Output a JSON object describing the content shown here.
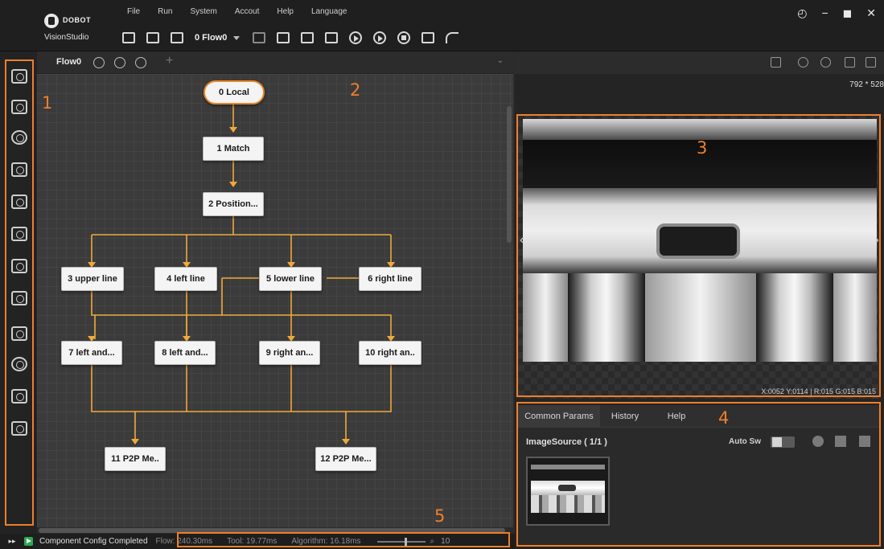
{
  "app": {
    "brand": "DOBOT",
    "product": "VisionStudio"
  },
  "menu": [
    "File",
    "Run",
    "System",
    "Accout",
    "Help",
    "Language"
  ],
  "toolbar": {
    "flow_select": "0 Flow0"
  },
  "window_controls": [
    "settings-icon",
    "minimize-icon",
    "maximize-icon",
    "close-icon"
  ],
  "toolbox_icons": [
    "tools-icon",
    "camera-icon",
    "locate-icon",
    "measure-icon",
    "recognize-icon",
    "calibrate-icon",
    "align-icon",
    "image-process-icon",
    "color-icon",
    "logic-icon",
    "if-icon",
    "comm-icon"
  ],
  "flow": {
    "tab_label": "Flow0",
    "nodes": [
      {
        "id": "0",
        "label": "0 Local"
      },
      {
        "id": "1",
        "label": "1 Match"
      },
      {
        "id": "2",
        "label": "2 Position..."
      },
      {
        "id": "3",
        "label": "3 upper line"
      },
      {
        "id": "4",
        "label": "4 left line"
      },
      {
        "id": "5",
        "label": "5 lower line"
      },
      {
        "id": "6",
        "label": "6 right line"
      },
      {
        "id": "7",
        "label": "7 left and..."
      },
      {
        "id": "8",
        "label": "8 left and..."
      },
      {
        "id": "9",
        "label": "9 right an..."
      },
      {
        "id": "10",
        "label": "10 right an.."
      },
      {
        "id": "11",
        "label": "11 P2P Me.."
      },
      {
        "id": "12",
        "label": "12 P2P Me..."
      }
    ]
  },
  "status": {
    "message": "Component Config Completed",
    "flow_time": "Flow: 240.30ms",
    "tool_time": "Tool: 19.77ms",
    "algorithm_time": "Algorithm: 16.18ms",
    "zoom": "10"
  },
  "viewer": {
    "resolution": "792 * 528",
    "pixel_info": "X:0052  Y:0114  |  R:015  G:015  B:015"
  },
  "params": {
    "tabs": [
      "Common Params",
      "History",
      "Help"
    ],
    "active_tab": "Common Params",
    "image_source": "ImageSource ( 1/1 )",
    "auto_switch": "Auto Sw"
  },
  "annotations": [
    "1",
    "2",
    "3",
    "4",
    "5"
  ],
  "colors": {
    "accent": "#f07f2b",
    "status_ok": "#2fa84f"
  }
}
